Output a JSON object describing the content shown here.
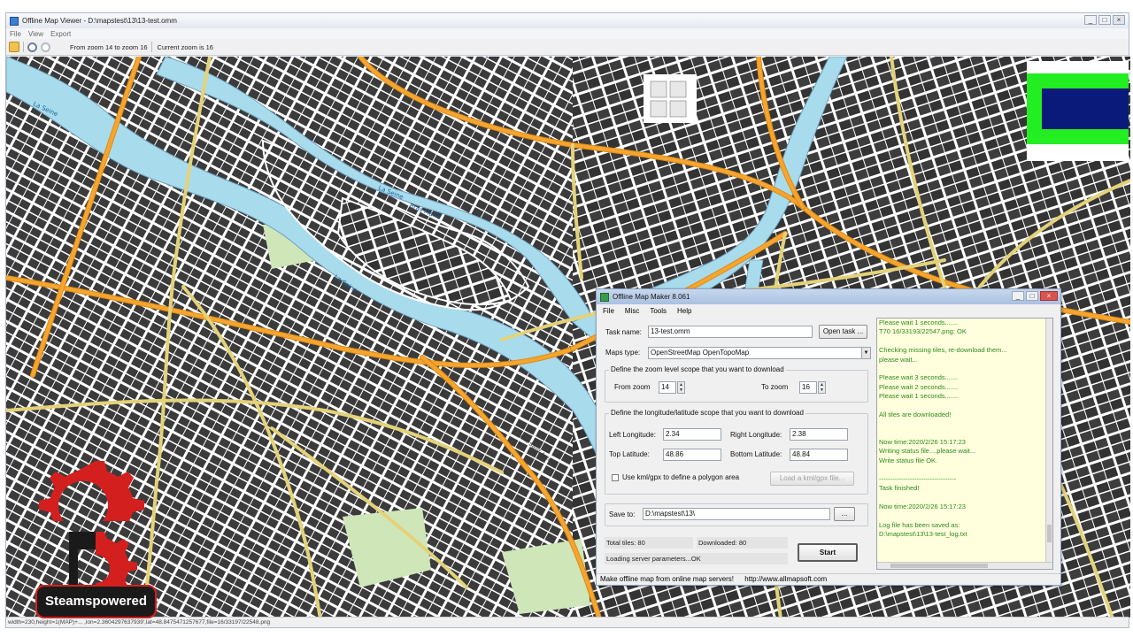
{
  "viewer": {
    "title": "Offline Map Viewer - D:\\mapstest\\13\\13-test.omm",
    "menu": [
      "File",
      "View",
      "Export"
    ],
    "zoom_range_text": "From zoom 14 to zoom 16",
    "current_zoom_text": "Current zoom is 16",
    "status_text": "width=230,height=1(MAP)+...  ,lon=2.3604297637939',lat=48.8475471257677,file=16/33197/22548.png",
    "window_buttons": [
      "_",
      "□",
      "×"
    ]
  },
  "map": {
    "colors": {
      "block": "#3b3b3b",
      "street": "#ffffff",
      "river": "#a8dcec",
      "primary_road": "#f5a531",
      "secondary_road": "#e4d27a",
      "park": "#cfe6b8"
    },
    "labels": [
      "La Seine",
      "La Seine",
      "Bras Marie",
      "La Seine",
      "Rue Saint-Antoine"
    ]
  },
  "dialog": {
    "title": "Offline Map Maker 8.061",
    "menu": [
      "File",
      "Misc",
      "Tools",
      "Help"
    ],
    "task_name_label": "Task name:",
    "task_name_value": "13-test.omm",
    "open_task_label": "Open task ...",
    "maps_type_label": "Maps type:",
    "maps_type_value": "OpenStreetMap OpenTopoMap",
    "zoom_group_title": "Define the zoom level scope that you want to download",
    "from_zoom_label": "From zoom",
    "from_zoom_value": "14",
    "to_zoom_label": "To zoom",
    "to_zoom_value": "16",
    "lonlat_group_title": "Define the longitude/latitude scope that you want to download",
    "left_lon_label": "Left Longitude:",
    "left_lon_value": "2.34",
    "right_lon_label": "Right Longitude:",
    "right_lon_value": "2.38",
    "top_lat_label": "Top Latitude:",
    "top_lat_value": "48.86",
    "bottom_lat_label": "Bottom Latitude:",
    "bottom_lat_value": "48.84",
    "kml_label": "Use kml/gpx to define a polygon area",
    "kml_checked": false,
    "load_kml_label": "Load a kml/gpx file...",
    "save_to_label": "Save to:",
    "save_to_value": "D:\\mapstest\\13\\",
    "browse_label": "...",
    "total_tiles_text": "Total tiles: 80",
    "downloaded_text": "Downloaded: 80",
    "loading_text": "Loading server parameters...OK",
    "start_label": "Start",
    "status_left": "Make offline map from online map servers!",
    "status_right": "http://www.allmapsoft.com",
    "window_buttons": [
      "_",
      "□",
      "×"
    ],
    "log": [
      "Please wait 1 seconds.......",
      "T70 16/33193/22547.png: OK",
      "",
      "Checking missing tiles, re-download them...",
      "please wait...",
      "",
      "Please wait 3 seconds.......",
      "Please wait 2 seconds.......",
      "Please wait 1 seconds.......",
      "",
      "All tiles are downloaded!",
      "",
      "",
      "Now time:2020/2/26 15:17:23",
      "Writing status file....please wait...",
      "Write status file OK.",
      "",
      "-----------------------------------",
      "Task finished!",
      "",
      "Now time:2020/2/26 15:17:23",
      "",
      "Log file has been saved as:",
      "D:\\mapstest\\13\\13-test_log.txt"
    ]
  },
  "watermark": {
    "text": "Steamspowered"
  }
}
